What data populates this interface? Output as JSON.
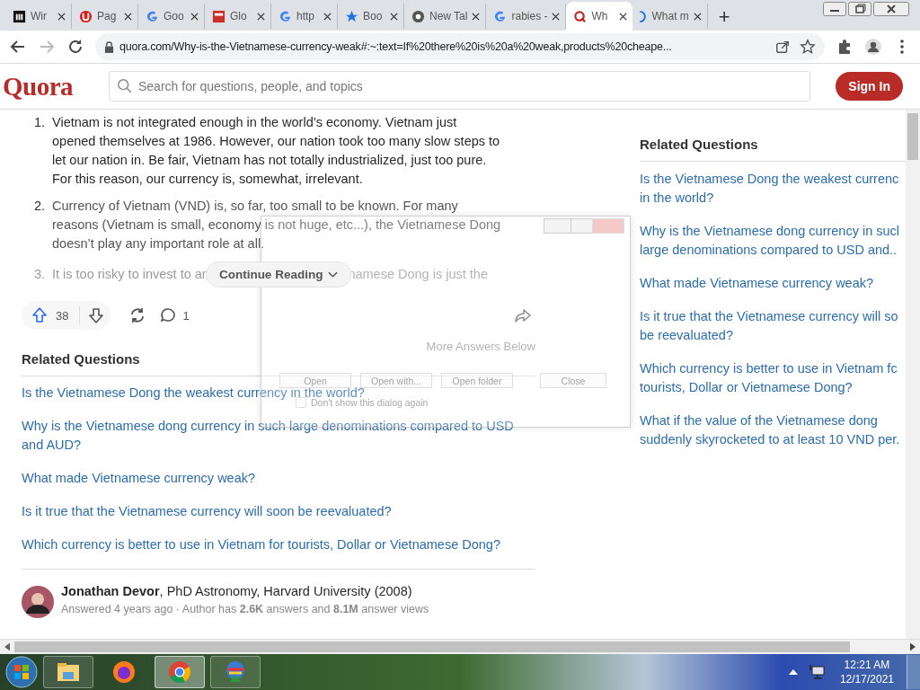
{
  "tabs": [
    {
      "label": "Wir",
      "kind": "museum",
      "selected": false
    },
    {
      "label": "Pag",
      "kind": "letter",
      "selected": false
    },
    {
      "label": "Goo",
      "kind": "google",
      "selected": false
    },
    {
      "label": "Glo",
      "kind": "square",
      "selected": false
    },
    {
      "label": "http",
      "kind": "google",
      "selected": false
    },
    {
      "label": "Boo",
      "kind": "star",
      "selected": false
    },
    {
      "label": "New Tal",
      "kind": "chrome",
      "selected": false
    },
    {
      "label": "rabies -",
      "kind": "google",
      "selected": false
    },
    {
      "label": "Wh",
      "kind": "quora",
      "selected": true
    },
    {
      "label": "What m",
      "kind": "loading",
      "selected": false
    }
  ],
  "new_tab": "+",
  "address": {
    "url": "quora.com/Why-is-the-Vietnamese-currency-weak#:~:text=If%20there%20is%20a%20weak,products%20cheape..."
  },
  "quora": {
    "logo": "Quora",
    "search_placeholder": "Search for questions, people, and topics",
    "sign_in": "Sign In"
  },
  "answer": {
    "items": [
      {
        "number": "1.",
        "text": "Vietnam is not integrated enough in the world’s economy. Vietnam just opened themselves at 1986. However, our nation took too many slow steps to let our nation in. Be fair, Vietnam has not totally industrialized, just too pure. For this reason, our currency is, somewhat, irrelevant."
      },
      {
        "number": "2.",
        "text": "Currency of Vietnam (VND) is, so far, too small to be known. For many reasons (Vietnam is small, economy is not huge, etc...), the Vietnamese Dong doesn’t play any important role at all."
      }
    ],
    "faded_item": {
      "number": "3.",
      "before": "It is too risky to invest to an",
      "after": "namese Dong is just the"
    },
    "continue_reading": "Continue Reading",
    "upvotes": "38",
    "comments": "1",
    "more_answers": "More Answers Below"
  },
  "related_left": {
    "title": "Related Questions",
    "items": [
      "Is the Vietnamese Dong the weakest currency in the world?",
      "Why is the Vietnamese dong currency in such large denominations compared to USD and AUD?",
      "What made Vietnamese currency weak?",
      "Is it true that the Vietnamese currency will soon be reevaluated?",
      "Which currency is better to use in Vietnam for tourists, Dollar or Vietnamese Dong?"
    ]
  },
  "author": {
    "name": "Jonathan Devor",
    "credential": ", PhD Astronomy, Harvard University (2008)",
    "meta": "Answered 4 years ago · Author has **2.6K** answers and **8.1M** answer views"
  },
  "related_right": {
    "title": "Related Questions",
    "items": [
      {
        "lines": [
          "Is the Vietnamese Dong the weakest currenc",
          "in the world?"
        ]
      },
      {
        "lines": [
          "Why is the Vietnamese dong currency in sucl",
          "large denominations compared to USD and.."
        ]
      },
      {
        "lines": [
          "What made Vietnamese currency weak?"
        ]
      },
      {
        "lines": [
          "Is it true that the Vietnamese currency will so",
          "be reevaluated?"
        ]
      },
      {
        "lines": [
          "Which currency is better to use in Vietnam fc",
          "tourists, Dollar or Vietnamese Dong?"
        ]
      },
      {
        "lines": [
          "What if the value of the Vietnamese dong",
          "suddenly skyrocketed to at least 10 VND per."
        ]
      }
    ]
  },
  "dialog": {
    "buttons": [
      "Open",
      "Open with...",
      "Open folder",
      "Close"
    ],
    "checkbox": {
      "label": "Don't show this dialog again",
      "checked": false
    }
  },
  "taskbar": {
    "apps": [
      {
        "kind": "folder",
        "selected": false
      },
      {
        "kind": "firefox",
        "selected": false
      },
      {
        "kind": "chrome",
        "selected": true
      },
      {
        "kind": "globe",
        "selected": false
      }
    ],
    "time": "12:21 AM",
    "date": "12/17/2021"
  }
}
